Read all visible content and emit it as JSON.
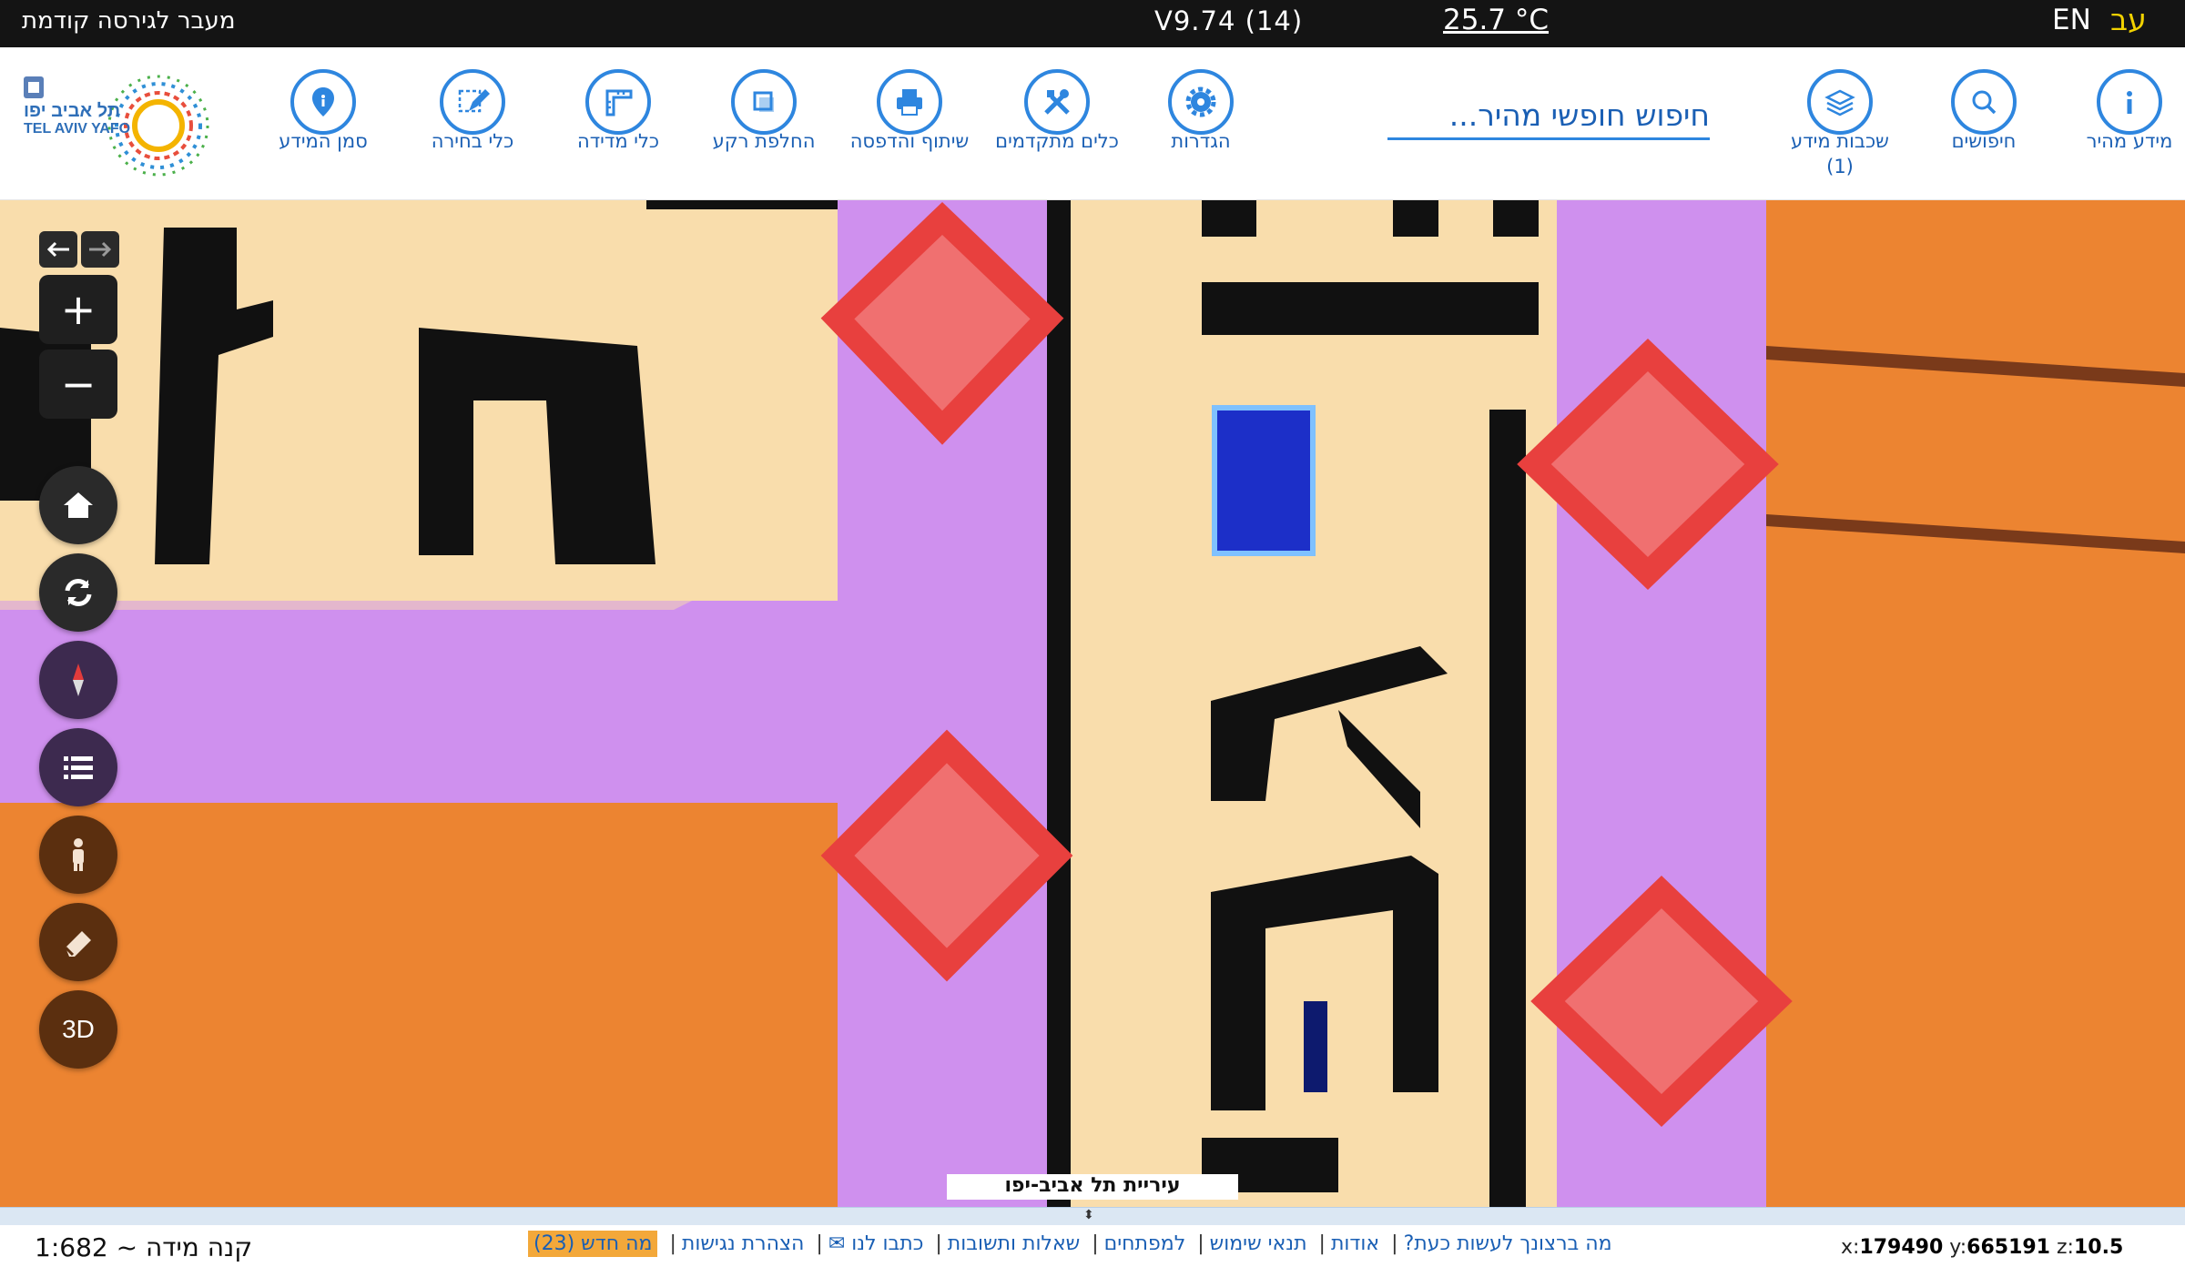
{
  "topbar": {
    "prev_version": "מעבר לגירסה קודמת",
    "version": "V9.74 (14)",
    "temperature": "25.7 °C",
    "lang_en": "EN",
    "lang_he": "עב"
  },
  "toolbar": {
    "tools_left": [
      {
        "label": "סמן המידע",
        "icon": "info-pin-icon"
      },
      {
        "label": "כלי בחירה",
        "icon": "pencil-select-icon"
      },
      {
        "label": "כלי מדידה",
        "icon": "ruler-icon"
      },
      {
        "label": "החלפת רקע",
        "icon": "layers-switch-icon"
      },
      {
        "label": "שיתוף והדפסה",
        "icon": "printer-icon"
      },
      {
        "label": "כלים מתקדמים",
        "icon": "tools-icon"
      },
      {
        "label": "הגדרות",
        "icon": "gear-icon"
      }
    ],
    "search_placeholder": "חיפוש חופשי מהיר...",
    "tools_right": [
      {
        "label": "שכבות מידע",
        "sublabel": "(1)",
        "icon": "layers-icon"
      },
      {
        "label": "חיפושים",
        "icon": "search-icon"
      },
      {
        "label": "מידע מהיר",
        "icon": "info-icon"
      }
    ],
    "logo": {
      "text_he": "תל אביב יפו",
      "text_en": "TEL AVIV YAFO"
    }
  },
  "map": {
    "controls": [
      "home-icon",
      "refresh-icon",
      "compass-icon",
      "list-icon",
      "street-view-icon",
      "eraser-icon"
    ],
    "btn_3d": "3D",
    "zoom_in": "+",
    "zoom_out": "−",
    "attribution": "עיריית תל אביב-יפו"
  },
  "footer": {
    "scale": "קנה מידה ~ 1:682",
    "links": [
      "מה ברצונך לעשות כעת?",
      "אודות",
      "תנאי שימוש",
      "למפתחים",
      "שאלות ותשובות",
      "כתבו לנו ✉",
      "הצהרת נגישות"
    ],
    "whats_new": "מה חדש (23)",
    "coords": {
      "x_label": "x:",
      "x": "179490",
      "y_label": "y:",
      "y": "665191",
      "z_label": "z:",
      "z": "10.5"
    }
  }
}
